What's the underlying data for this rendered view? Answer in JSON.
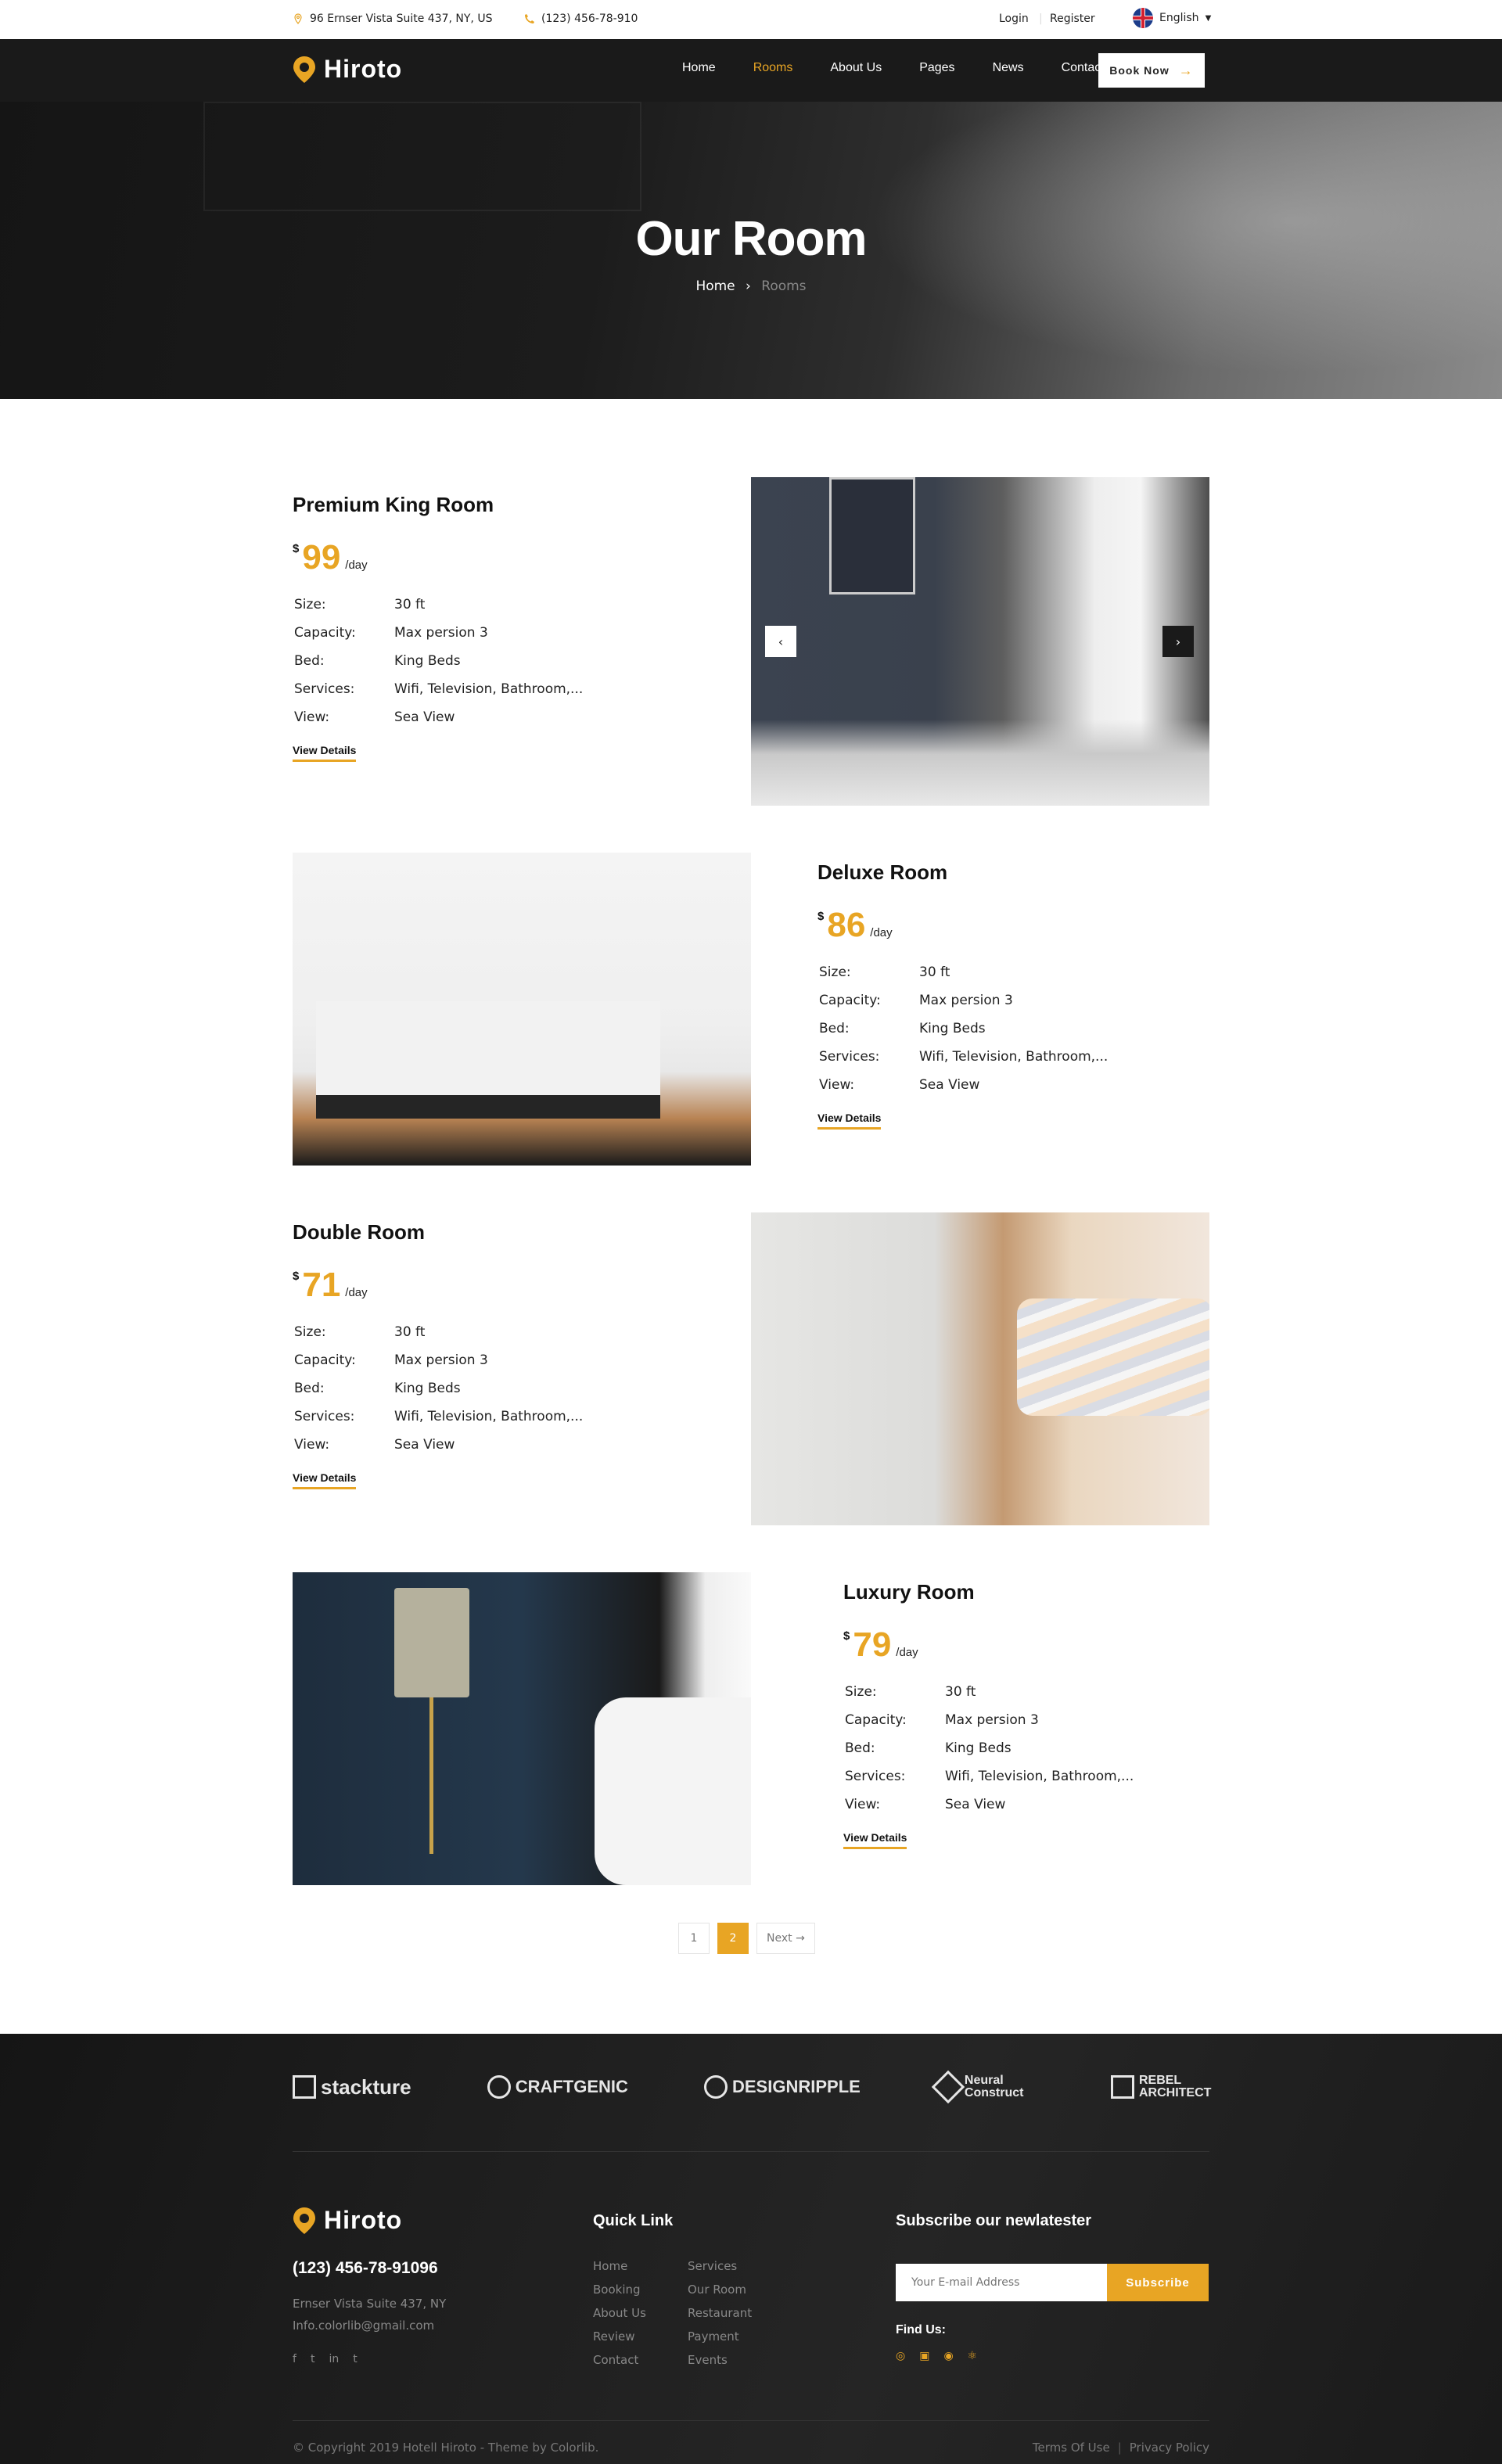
{
  "topbar": {
    "address": "96 Ernser Vista Suite 437, NY, US",
    "phone": "(123) 456-78-910",
    "login": "Login",
    "register": "Register",
    "language": "English"
  },
  "nav": {
    "brand": "Hiroto",
    "links": [
      "Home",
      "Rooms",
      "About Us",
      "Pages",
      "News",
      "Contact"
    ],
    "active": "Rooms",
    "book_button": "Book Now",
    "accent_color": "#e8a524"
  },
  "hero": {
    "title": "Our Room",
    "breadcrumb_home": "Home",
    "breadcrumb_separator": "›",
    "breadcrumb_current": "Rooms"
  },
  "spec_labels": {
    "size": "Size:",
    "capacity": "Capacity:",
    "bed": "Bed:",
    "services": "Services:",
    "view": "View:"
  },
  "rooms": [
    {
      "name": "Premium King Room",
      "currency": "$",
      "price": "99",
      "per": "/day",
      "size": "30 ft",
      "capacity": "Max persion 3",
      "bed": "King Beds",
      "services": "Wifi, Television, Bathroom,...",
      "view": "Sea View",
      "link": "View Details"
    },
    {
      "name": "Deluxe Room",
      "currency": "$",
      "price": "86",
      "per": "/day",
      "size": "30 ft",
      "capacity": "Max persion 3",
      "bed": "King Beds",
      "services": "Wifi, Television, Bathroom,...",
      "view": "Sea View",
      "link": "View Details"
    },
    {
      "name": "Double Room",
      "currency": "$",
      "price": "71",
      "per": "/day",
      "size": "30 ft",
      "capacity": "Max persion 3",
      "bed": "King Beds",
      "services": "Wifi, Television, Bathroom,...",
      "view": "Sea View",
      "link": "View Details"
    },
    {
      "name": "Luxury Room",
      "currency": "$",
      "price": "79",
      "per": "/day",
      "size": "30 ft",
      "capacity": "Max persion 3",
      "bed": "King Beds",
      "services": "Wifi, Television, Bathroom,...",
      "view": "Sea View",
      "link": "View Details"
    }
  ],
  "slider": {
    "prev_icon": "‹",
    "next_icon": "›"
  },
  "pagination": {
    "pages": [
      "1",
      "2"
    ],
    "current": "2",
    "next": "Next →"
  },
  "partners": [
    "stackture",
    "CRAFTGENIC",
    "DESIGNRIPPLE",
    "Neural Construct",
    "REBEL ARCHITECT"
  ],
  "footer": {
    "brand": "Hiroto",
    "phone": "(123) 456-78-91096",
    "address": "Ernser Vista Suite 437, NY",
    "email": "Info.colorlib@gmail.com",
    "social": [
      "f",
      "t",
      "in",
      "t"
    ],
    "quick_link_title": "Quick Link",
    "quick_links_col1": [
      "Home",
      "Booking",
      "About Us",
      "Review",
      "Contact"
    ],
    "quick_links_col2": [
      "Services",
      "Our Room",
      "Restaurant",
      "Payment",
      "Events"
    ],
    "subscribe_title": "Subscribe our newlatester",
    "email_placeholder": "Your E-mail Address",
    "subscribe_button": "Subscribe",
    "find_us": "Find Us:",
    "copyright": "© Copyright 2019 Hotell Hiroto - Theme by Colorlib.",
    "terms": "Terms Of Use",
    "legal_separator": "|",
    "privacy": "Privacy Policy"
  }
}
